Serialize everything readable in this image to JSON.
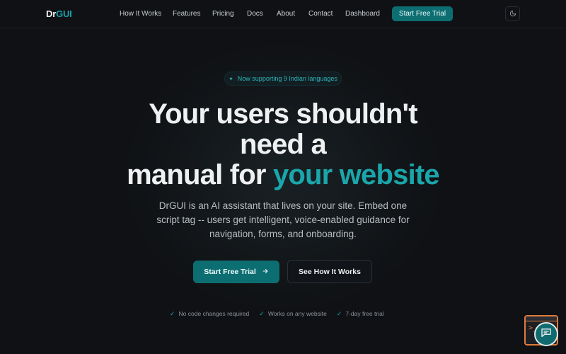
{
  "brand": {
    "prefix": "Dr",
    "highlight": "GUI"
  },
  "nav": {
    "links": [
      "How It Works",
      "Features",
      "Pricing",
      "Docs",
      "About",
      "Contact",
      "Dashboard"
    ],
    "cta": "Start Free Trial",
    "theme_icon": "moon-icon"
  },
  "hero": {
    "pill": "Now supporting 9 Indian languages",
    "title_line1": "Your users shouldn't",
    "title_line2": "need a",
    "title_line3_plain": "manual for ",
    "title_line3_accent": "your website",
    "description": "DrGUI is an AI assistant that lives on your site. Embed one script tag -- users get intelligent, voice-enabled guidance for navigation, forms, and onboarding.",
    "primary_cta": "Start Free Trial",
    "secondary_cta": "See How It Works",
    "features": [
      "No code changes required",
      "Works on any website",
      "7-day free trial"
    ]
  },
  "widget": {
    "prompt": ">_"
  },
  "colors": {
    "accent": "#1aa6aa",
    "button": "#0d6e72",
    "background": "#0f1114",
    "widget_border": "#e07a3a"
  }
}
